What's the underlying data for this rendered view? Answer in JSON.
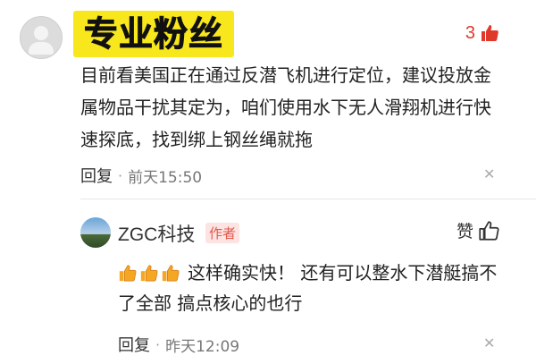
{
  "header": {
    "title_badge": "专业粉丝",
    "like_count": "3"
  },
  "comment": {
    "text": "目前看美国正在通过反潜飞机进行定位，建议投放金属物品干扰其定为，咱们使用水下无人滑翔机进行快速探底，找到绑上钢丝绳就拖",
    "reply_label": "回复",
    "time": "前天15:50"
  },
  "reply": {
    "name": "ZGC科技",
    "author_tag": "作者",
    "like_label": "赞",
    "text": "这样确实快！ 还有可以整水下潜艇搞不了全部 搞点核心的也行",
    "reply_label": "回复",
    "time": "昨天12:09",
    "emoji_count": 3
  },
  "colors": {
    "badge": "#f8e71c",
    "like_red": "#e0392b",
    "author_tag": "#e2574c"
  },
  "icons": [
    "user-avatar",
    "thumb-up-icon",
    "close-icon",
    "thumbs-up-emoji"
  ]
}
